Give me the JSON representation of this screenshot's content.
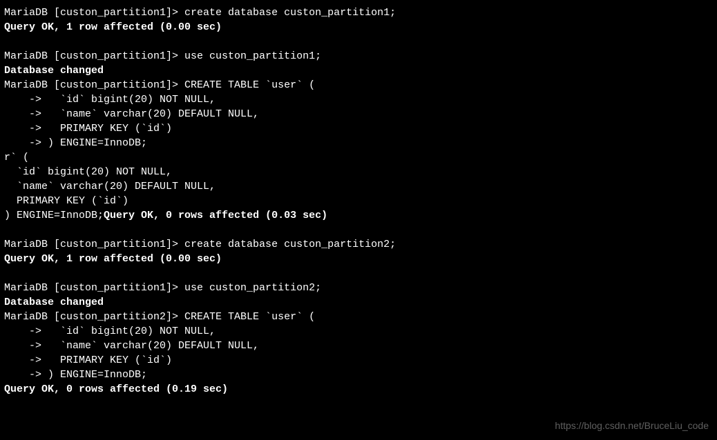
{
  "terminal": {
    "lines": [
      {
        "text": "MariaDB [custon_partition1]> create database custon_partition1;",
        "bold": false
      },
      {
        "text": "Query OK, 1 row affected (0.00 sec)",
        "bold": true
      },
      {
        "text": "",
        "bold": false
      },
      {
        "text": "MariaDB [custon_partition1]> use custon_partition1;",
        "bold": false
      },
      {
        "text": "Database changed",
        "bold": true
      },
      {
        "text": "MariaDB [custon_partition1]> CREATE TABLE `user` (",
        "bold": false
      },
      {
        "text": "    ->   `id` bigint(20) NOT NULL,",
        "bold": false
      },
      {
        "text": "    ->   `name` varchar(20) DEFAULT NULL,",
        "bold": false
      },
      {
        "text": "    ->   PRIMARY KEY (`id`)",
        "bold": false
      },
      {
        "text": "    -> ) ENGINE=InnoDB;",
        "bold": false
      },
      {
        "text": "r` (",
        "bold": false
      },
      {
        "text": "  `id` bigint(20) NOT NULL,",
        "bold": false
      },
      {
        "text": "  `name` varchar(20) DEFAULT NULL,",
        "bold": false
      },
      {
        "text": "  PRIMARY KEY (`id`)",
        "bold": false
      }
    ],
    "mixed_line": {
      "prefix": ") ENGINE=InnoDB;",
      "suffix": "Query OK, 0 rows affected (0.03 sec)"
    },
    "lines2": [
      {
        "text": "",
        "bold": false
      },
      {
        "text": "MariaDB [custon_partition1]> create database custon_partition2;",
        "bold": false
      },
      {
        "text": "Query OK, 1 row affected (0.00 sec)",
        "bold": true
      },
      {
        "text": "",
        "bold": false
      },
      {
        "text": "MariaDB [custon_partition1]> use custon_partition2;",
        "bold": false
      },
      {
        "text": "Database changed",
        "bold": true
      },
      {
        "text": "MariaDB [custon_partition2]> CREATE TABLE `user` (",
        "bold": false
      },
      {
        "text": "    ->   `id` bigint(20) NOT NULL,",
        "bold": false
      },
      {
        "text": "    ->   `name` varchar(20) DEFAULT NULL,",
        "bold": false
      },
      {
        "text": "    ->   PRIMARY KEY (`id`)",
        "bold": false
      },
      {
        "text": "    -> ) ENGINE=InnoDB;",
        "bold": false
      },
      {
        "text": "Query OK, 0 rows affected (0.19 sec)",
        "bold": true
      }
    ]
  },
  "watermark": "https://blog.csdn.net/BruceLiu_code"
}
